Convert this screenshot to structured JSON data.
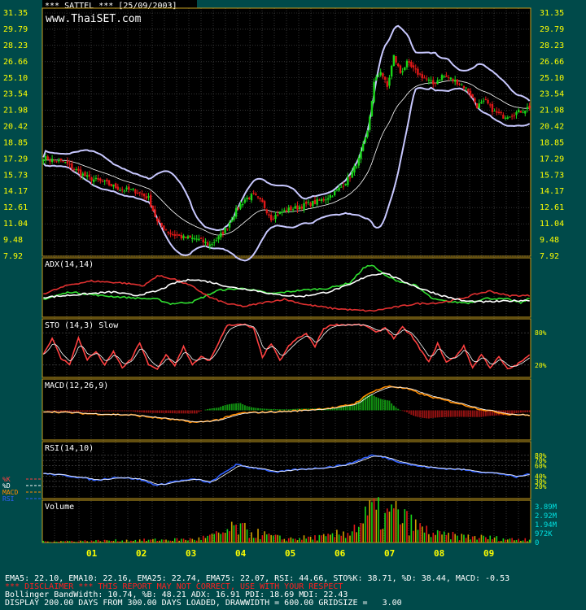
{
  "header": {
    "title": "*** SATTEL *** [25/09/2003]",
    "watermark": "www.ThaiSET.com"
  },
  "colors": {
    "background": "#004a4a",
    "plot_bg": "#000000",
    "grid": "#555555",
    "frame": "#c8a020",
    "axis_text": "#ffff00",
    "up_candle": "#18d418",
    "down_candle": "#e01818",
    "bollinger": "#c8c8ff",
    "ema": "#ffffff",
    "adx_plus": "#30e030",
    "adx_minus": "#e03030",
    "stoch_k": "#ff4040",
    "stoch_d": "#ffffff",
    "macd": "#ff8c00",
    "rsi": "#3060ff"
  },
  "chart_data": [
    {
      "type": "candlestick",
      "name": "price",
      "yticks": [
        "31.35",
        "29.79",
        "28.23",
        "26.66",
        "25.10",
        "23.54",
        "21.98",
        "20.42",
        "18.85",
        "17.29",
        "15.73",
        "14.17",
        "12.61",
        "11.04",
        "9.48",
        "7.92"
      ],
      "ylim": [
        7.92,
        31.35
      ],
      "x_months": [
        "01",
        "02",
        "03",
        "04",
        "05",
        "06",
        "07",
        "08",
        "09"
      ],
      "close_anchors": [
        [
          0,
          17.4
        ],
        [
          10,
          16.9
        ],
        [
          20,
          15.5
        ],
        [
          28,
          15.0
        ],
        [
          35,
          14.4
        ],
        [
          42,
          14.2
        ],
        [
          48,
          13.5
        ],
        [
          52,
          11.2
        ],
        [
          58,
          10.1
        ],
        [
          64,
          9.7
        ],
        [
          70,
          9.6
        ],
        [
          76,
          9.0
        ],
        [
          80,
          9.7
        ],
        [
          84,
          10.8
        ],
        [
          88,
          12.3
        ],
        [
          92,
          13.4
        ],
        [
          96,
          13.8
        ],
        [
          100,
          13.0
        ],
        [
          104,
          11.6
        ],
        [
          108,
          12.1
        ],
        [
          112,
          12.4
        ],
        [
          116,
          12.6
        ],
        [
          120,
          12.9
        ],
        [
          124,
          13.1
        ],
        [
          128,
          13.4
        ],
        [
          132,
          13.9
        ],
        [
          136,
          14.6
        ],
        [
          140,
          15.6
        ],
        [
          144,
          17.2
        ],
        [
          148,
          19.8
        ],
        [
          151,
          24.6
        ],
        [
          154,
          25.8
        ],
        [
          157,
          24.2
        ],
        [
          160,
          27.2
        ],
        [
          163,
          25.6
        ],
        [
          166,
          26.5
        ],
        [
          170,
          25.7
        ],
        [
          174,
          25.1
        ],
        [
          178,
          24.5
        ],
        [
          182,
          25.3
        ],
        [
          186,
          25.0
        ],
        [
          190,
          24.6
        ],
        [
          194,
          23.9
        ],
        [
          198,
          22.4
        ],
        [
          202,
          22.8
        ],
        [
          206,
          21.8
        ],
        [
          210,
          21.4
        ],
        [
          214,
          21.6
        ],
        [
          218,
          21.9
        ],
        [
          222,
          22.3
        ]
      ],
      "volume": {
        "yticks": [
          "3.89M",
          "2.92M",
          "1.94M",
          "972K",
          "0"
        ],
        "ylim": [
          0,
          3890000
        ],
        "anchors": [
          [
            0,
            120000
          ],
          [
            40,
            250000
          ],
          [
            70,
            380000
          ],
          [
            80,
            900000
          ],
          [
            88,
            1700000
          ],
          [
            96,
            1100000
          ],
          [
            110,
            420000
          ],
          [
            130,
            650000
          ],
          [
            140,
            1300000
          ],
          [
            146,
            2500000
          ],
          [
            150,
            3700000
          ],
          [
            156,
            2800000
          ],
          [
            160,
            3500000
          ],
          [
            166,
            2400000
          ],
          [
            172,
            1600000
          ],
          [
            180,
            900000
          ],
          [
            190,
            700000
          ],
          [
            200,
            600000
          ],
          [
            215,
            350000
          ],
          [
            222,
            450000
          ]
        ]
      }
    },
    {
      "type": "line",
      "title": "ADX(14,14)",
      "ylim": [
        0,
        60
      ],
      "series": [
        {
          "name": "PDI",
          "anchors": [
            [
              0,
              18
            ],
            [
              12,
              26
            ],
            [
              26,
              22
            ],
            [
              44,
              19
            ],
            [
              52,
              18
            ],
            [
              58,
              13
            ],
            [
              68,
              15
            ],
            [
              80,
              28
            ],
            [
              92,
              30
            ],
            [
              104,
              24
            ],
            [
              118,
              28
            ],
            [
              130,
              30
            ],
            [
              140,
              36
            ],
            [
              146,
              52
            ],
            [
              150,
              56
            ],
            [
              156,
              44
            ],
            [
              162,
              38
            ],
            [
              170,
              33
            ],
            [
              178,
              18
            ],
            [
              186,
              15
            ],
            [
              194,
              14
            ],
            [
              202,
              19
            ],
            [
              212,
              18
            ],
            [
              218,
              14
            ],
            [
              222,
              19
            ]
          ]
        },
        {
          "name": "MDI",
          "anchors": [
            [
              0,
              24
            ],
            [
              12,
              34
            ],
            [
              22,
              38
            ],
            [
              36,
              36
            ],
            [
              46,
              33
            ],
            [
              52,
              44
            ],
            [
              60,
              40
            ],
            [
              68,
              32
            ],
            [
              76,
              20
            ],
            [
              84,
              13
            ],
            [
              92,
              10
            ],
            [
              100,
              14
            ],
            [
              110,
              18
            ],
            [
              120,
              12
            ],
            [
              132,
              8
            ],
            [
              142,
              6
            ],
            [
              150,
              5
            ],
            [
              160,
              9
            ],
            [
              170,
              13
            ],
            [
              180,
              14
            ],
            [
              190,
              18
            ],
            [
              198,
              24
            ],
            [
              204,
              27
            ],
            [
              212,
              22
            ],
            [
              222,
              22
            ]
          ]
        },
        {
          "name": "ADX",
          "anchors": [
            [
              0,
              20
            ],
            [
              10,
              22
            ],
            [
              20,
              24
            ],
            [
              32,
              26
            ],
            [
              42,
              22
            ],
            [
              52,
              27
            ],
            [
              60,
              36
            ],
            [
              68,
              40
            ],
            [
              76,
              37
            ],
            [
              86,
              31
            ],
            [
              96,
              28
            ],
            [
              106,
              23
            ],
            [
              118,
              21
            ],
            [
              130,
              26
            ],
            [
              140,
              34
            ],
            [
              148,
              44
            ],
            [
              156,
              47
            ],
            [
              164,
              38
            ],
            [
              172,
              30
            ],
            [
              182,
              22
            ],
            [
              192,
              16
            ],
            [
              202,
              15
            ],
            [
              212,
              16
            ],
            [
              222,
              17
            ]
          ]
        }
      ]
    },
    {
      "type": "line",
      "title": "STO (14,3) Slow",
      "yticks": [
        "80%",
        "20%"
      ],
      "ylim": [
        0,
        100
      ],
      "series": [
        {
          "name": "%K",
          "anchors": [
            [
              0,
              40
            ],
            [
              4,
              70
            ],
            [
              8,
              32
            ],
            [
              12,
              22
            ],
            [
              16,
              70
            ],
            [
              20,
              30
            ],
            [
              24,
              45
            ],
            [
              28,
              20
            ],
            [
              32,
              45
            ],
            [
              36,
              15
            ],
            [
              40,
              30
            ],
            [
              44,
              62
            ],
            [
              48,
              20
            ],
            [
              52,
              12
            ],
            [
              56,
              40
            ],
            [
              60,
              18
            ],
            [
              64,
              55
            ],
            [
              68,
              20
            ],
            [
              72,
              35
            ],
            [
              76,
              28
            ],
            [
              80,
              62
            ],
            [
              84,
              95
            ],
            [
              88,
              95
            ],
            [
              92,
              95
            ],
            [
              96,
              88
            ],
            [
              100,
              35
            ],
            [
              104,
              60
            ],
            [
              108,
              28
            ],
            [
              112,
              55
            ],
            [
              116,
              70
            ],
            [
              120,
              78
            ],
            [
              124,
              55
            ],
            [
              128,
              88
            ],
            [
              132,
              95
            ],
            [
              136,
              95
            ],
            [
              140,
              95
            ],
            [
              144,
              95
            ],
            [
              148,
              92
            ],
            [
              152,
              80
            ],
            [
              156,
              90
            ],
            [
              160,
              70
            ],
            [
              164,
              90
            ],
            [
              168,
              75
            ],
            [
              172,
              50
            ],
            [
              176,
              25
            ],
            [
              180,
              60
            ],
            [
              184,
              25
            ],
            [
              188,
              35
            ],
            [
              192,
              55
            ],
            [
              196,
              15
            ],
            [
              200,
              40
            ],
            [
              204,
              15
            ],
            [
              208,
              35
            ],
            [
              212,
              12
            ],
            [
              216,
              20
            ],
            [
              222,
              38
            ]
          ]
        }
      ]
    },
    {
      "type": "line",
      "title": "MACD(12,26,9)",
      "ylim": [
        -3,
        3
      ],
      "series": [
        {
          "name": "MACD",
          "anchors": [
            [
              0,
              -0.1
            ],
            [
              20,
              -0.35
            ],
            [
              40,
              -0.5
            ],
            [
              56,
              -0.9
            ],
            [
              70,
              -1.3
            ],
            [
              80,
              -1.0
            ],
            [
              90,
              -0.3
            ],
            [
              100,
              -0.2
            ],
            [
              112,
              -0.1
            ],
            [
              124,
              0.1
            ],
            [
              134,
              0.3
            ],
            [
              142,
              0.7
            ],
            [
              150,
              2.0
            ],
            [
              158,
              2.6
            ],
            [
              166,
              2.3
            ],
            [
              176,
              1.5
            ],
            [
              190,
              0.7
            ],
            [
              200,
              0.1
            ],
            [
              212,
              -0.4
            ],
            [
              222,
              -0.53
            ]
          ]
        }
      ]
    },
    {
      "type": "line",
      "title": "RSI(14,10)",
      "yticks": [
        "80%",
        "70%",
        "60%",
        "40%",
        "30%",
        "20%"
      ],
      "ylim": [
        0,
        100
      ],
      "series": [
        {
          "name": "RSI",
          "anchors": [
            [
              0,
              45
            ],
            [
              8,
              42
            ],
            [
              16,
              38
            ],
            [
              24,
              32
            ],
            [
              34,
              38
            ],
            [
              44,
              34
            ],
            [
              52,
              22
            ],
            [
              60,
              30
            ],
            [
              70,
              34
            ],
            [
              76,
              27
            ],
            [
              82,
              45
            ],
            [
              88,
              62
            ],
            [
              94,
              57
            ],
            [
              100,
              54
            ],
            [
              106,
              47
            ],
            [
              114,
              52
            ],
            [
              124,
              55
            ],
            [
              132,
              58
            ],
            [
              140,
              64
            ],
            [
              146,
              74
            ],
            [
              150,
              80
            ],
            [
              156,
              76
            ],
            [
              162,
              68
            ],
            [
              170,
              60
            ],
            [
              180,
              55
            ],
            [
              190,
              53
            ],
            [
              200,
              48
            ],
            [
              210,
              44
            ],
            [
              216,
              38
            ],
            [
              222,
              44.66
            ]
          ]
        }
      ]
    }
  ],
  "legend": {
    "items": [
      {
        "label": "%K",
        "color": "#ff4040"
      },
      {
        "label": "%D",
        "color": "#ffffff"
      },
      {
        "label": "MACD",
        "color": "#ff8c00"
      },
      {
        "label": "RSI",
        "color": "#3060ff"
      }
    ]
  },
  "volume_label": "Volume",
  "footer": {
    "line1": "EMA5: 22.10, EMA10: 22.16, EMA25: 22.74, EMA75: 22.07, RSI: 44.66, STO%K: 38.71, %D: 38.44, MACD: -0.53",
    "line2": "*** DISCLAIMER *** THIS REPORT MAY NOT CORRECT, USE WITH YOUR RESPECT",
    "line3": "Bollinger BandWidth: 10.74, %B: 48.21 ADX: 16.91 PDI: 18.69 MDI: 22.43",
    "line4": "DISPLAY 200.00 DAYS FROM 300.00 DAYS LOADED, DRAWWIDTH = 600.00 GRIDSIZE =   3.00"
  }
}
